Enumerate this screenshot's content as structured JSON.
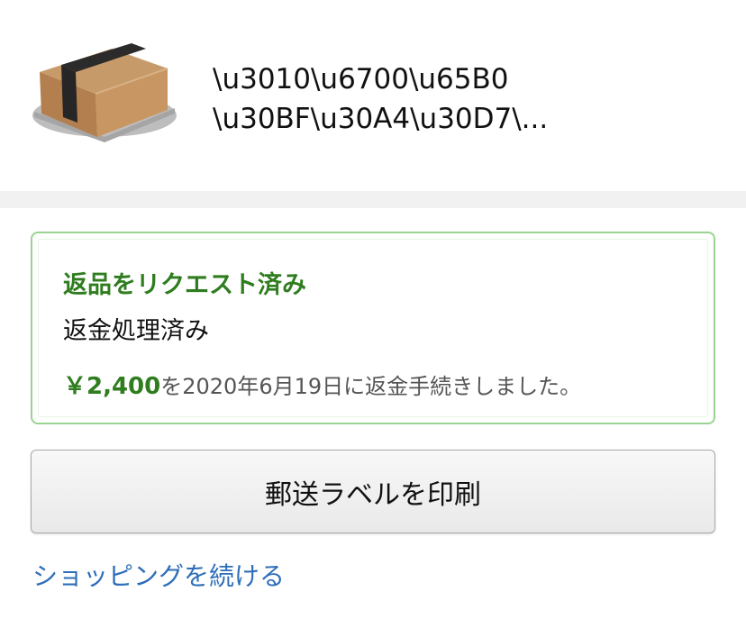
{
  "product": {
    "icon": "package-box-icon",
    "title_line1": "\\u3010\\u6700\\u65B0",
    "title_line2": "\\u30BF\\u30A4\\u30D7\\..."
  },
  "status": {
    "heading": "返品をリクエスト済み",
    "subheading": "返金処理済み",
    "amount": "￥2,400",
    "detail_suffix": "を2020年6月19日に返金手続きしました。"
  },
  "actions": {
    "print_label": "郵送ラベルを印刷",
    "continue_shopping": "ショッピングを続ける"
  },
  "colors": {
    "success_green": "#2f7d1f",
    "box_border": "#9ad391",
    "link_blue": "#2e6eb8"
  }
}
